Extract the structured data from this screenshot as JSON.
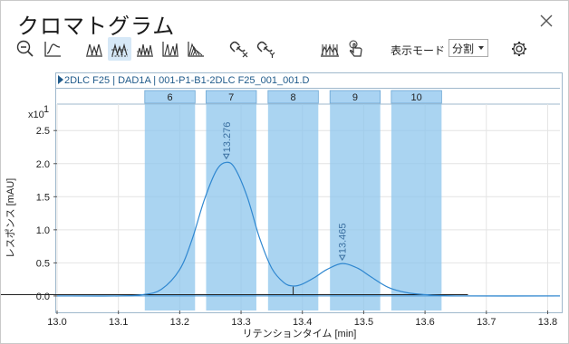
{
  "window": {
    "title": "クロマトグラム",
    "close_icon": "close-icon"
  },
  "toolbar": {
    "icons": [
      "zoom-out-icon",
      "baseline-icon",
      "overlay-peaks-icon",
      "stacked-peaks-icon",
      "separate-peaks-icon",
      "split-traces-icon",
      "cascade-traces-icon",
      "link-x-icon",
      "link-y-icon",
      "fraction-display-icon",
      "touch-icon",
      "settings-icon"
    ],
    "mode_label": "表示モード",
    "mode_value": "分割"
  },
  "trace_title": "2DLC F25 | DAD1A | 001-P1-B1-2DLC F25_001_001.D",
  "chart_data": {
    "type": "line",
    "xlabel": "リテンションタイム [min]",
    "ylabel": "レスポンス [mAU]",
    "y_multiplier": "x10",
    "y_multiplier_exp": "1",
    "xlim": [
      13.0,
      13.82
    ],
    "ylim": [
      -0.22,
      2.9
    ],
    "x_ticks": [
      "13.0",
      "13.1",
      "13.2",
      "13.3",
      "13.4",
      "13.5",
      "13.6",
      "13.7",
      "13.8"
    ],
    "y_ticks": [
      "0.0",
      "0.5",
      "1.0",
      "1.5",
      "2.0",
      "2.5"
    ],
    "grid": true,
    "fractions": [
      {
        "label": "6",
        "start": 13.143,
        "end": 13.225
      },
      {
        "label": "7",
        "start": 13.243,
        "end": 13.325
      },
      {
        "label": "8",
        "start": 13.344,
        "end": 13.426
      },
      {
        "label": "9",
        "start": 13.445,
        "end": 13.527
      },
      {
        "label": "10",
        "start": 13.545,
        "end": 13.627
      }
    ],
    "peaks": [
      {
        "label": "13.276",
        "x": 13.276,
        "y": 2.02
      },
      {
        "label": "13.465",
        "x": 13.465,
        "y": 0.49
      }
    ],
    "series": [
      {
        "x": [
          13.0,
          13.1,
          13.14,
          13.17,
          13.2,
          13.22,
          13.24,
          13.26,
          13.276,
          13.29,
          13.31,
          13.33,
          13.35,
          13.37,
          13.385,
          13.4,
          13.42,
          13.44,
          13.465,
          13.49,
          13.51,
          13.54,
          13.57,
          13.6,
          13.65,
          13.82
        ],
        "y": [
          0.0,
          0.0,
          0.02,
          0.1,
          0.4,
          0.85,
          1.45,
          1.9,
          2.02,
          1.93,
          1.5,
          0.88,
          0.42,
          0.2,
          0.15,
          0.18,
          0.28,
          0.4,
          0.49,
          0.42,
          0.3,
          0.13,
          0.05,
          0.02,
          0.0,
          0.0
        ]
      }
    ]
  }
}
